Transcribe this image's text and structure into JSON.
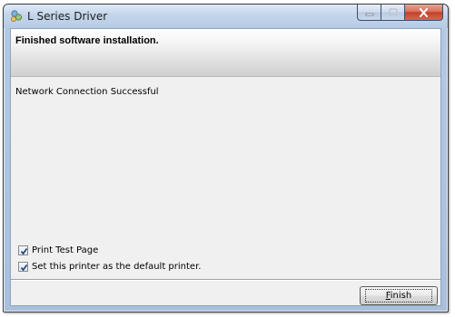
{
  "window": {
    "title": "L Series Driver",
    "icon": "printer-driver-icon"
  },
  "header": {
    "title": "Finished software installation."
  },
  "main": {
    "status": "Network Connection Successful"
  },
  "options": [
    {
      "label": "Print Test Page",
      "checked": true
    },
    {
      "label": "Set this printer as the default printer.",
      "checked": true
    }
  ],
  "footer": {
    "finish_label_first": "F",
    "finish_label_rest": "inish"
  },
  "colors": {
    "close_button": "#c4412a",
    "title_bar": "#b6cbe4",
    "content_bg": "#f0f0f0"
  }
}
